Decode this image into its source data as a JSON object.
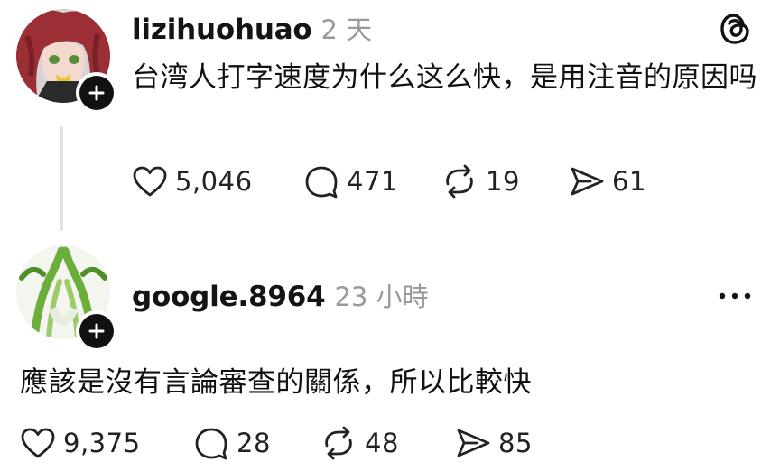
{
  "colors": {
    "text": "#111111",
    "muted": "#9a9a9a",
    "badge": "#111111",
    "thread_line": "#e2e2e2"
  },
  "posts": [
    {
      "avatar_icon": "anime-girl-avatar",
      "username": "lizihuohuao",
      "timestamp": "2 天",
      "text": "台湾人打字速度为什么这么快，是用注音的原因吗",
      "stats": {
        "likes": "5,046",
        "comments": "471",
        "reposts": "19",
        "shares": "61"
      },
      "header_icon": "threads-logo-icon"
    },
    {
      "avatar_icon": "green-onion-avatar",
      "username": "google.8964",
      "timestamp": "23 小時",
      "text": "應該是沒有言論審查的關係，所以比較快",
      "stats": {
        "likes": "9,375",
        "comments": "28",
        "reposts": "48",
        "shares": "85"
      },
      "header_icon": "more-options-icon"
    }
  ]
}
